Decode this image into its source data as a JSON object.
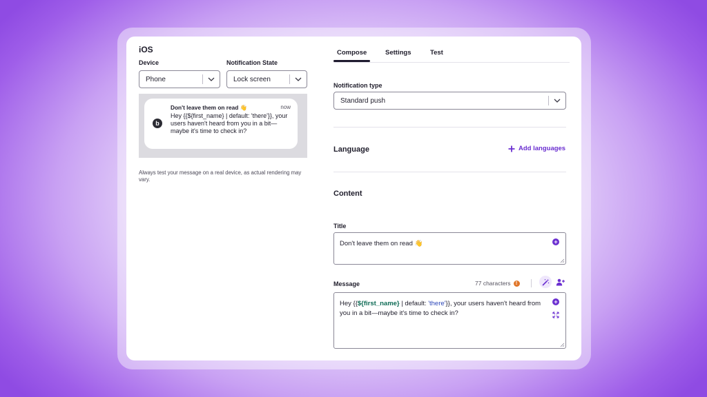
{
  "left": {
    "platform": "iOS",
    "device_label": "Device",
    "device_value": "Phone",
    "state_label": "Notification State",
    "state_value": "Lock screen",
    "preview": {
      "app_icon_letter": "b",
      "title": "Don't leave them on read 👋",
      "time": "now",
      "body": "Hey {{${first_name} | default: 'there'}}, your users haven't heard from you in a bit—maybe it's time to check in?"
    },
    "hint": "Always test your message on a real device, as actual rendering may vary."
  },
  "tabs": [
    {
      "label": "Compose",
      "active": true
    },
    {
      "label": "Settings",
      "active": false
    },
    {
      "label": "Test",
      "active": false
    }
  ],
  "notification_type": {
    "label": "Notification type",
    "value": "Standard push"
  },
  "language": {
    "heading": "Language",
    "add_label": "Add languages"
  },
  "content": {
    "heading": "Content",
    "title_label": "Title",
    "title_value": "Don't leave them on read 👋",
    "message_label": "Message",
    "char_count": "77 characters",
    "info_glyph": "!",
    "message": {
      "open_brace": "Hey {{",
      "variable": "${first_name}",
      "filter_text": " | default: ",
      "string_literal": "'there'",
      "close_brace": "}}",
      "rest_line1": ", your users haven't heard from",
      "line2": "you in a bit—maybe it's time to check in?"
    }
  },
  "colors": {
    "accent": "#6b2fd0",
    "variable": "#0e6b55",
    "string": "#2c47b8",
    "warning": "#e0762a"
  }
}
